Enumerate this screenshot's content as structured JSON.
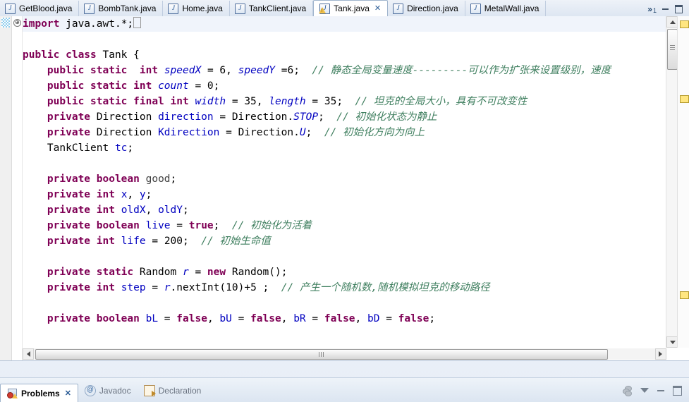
{
  "window": {
    "minimize_label": "Minimize",
    "maximize_label": "Maximize"
  },
  "editor_tabs": {
    "overflow_indicator": "»",
    "overflow_count": "1",
    "items": [
      {
        "label": "GetBlood.java",
        "icon": "java-file-icon",
        "active": false,
        "warning": false
      },
      {
        "label": "BombTank.java",
        "icon": "java-file-icon",
        "active": false,
        "warning": false
      },
      {
        "label": "Home.java",
        "icon": "java-file-icon",
        "active": false,
        "warning": false
      },
      {
        "label": "TankClient.java",
        "icon": "java-file-icon",
        "active": false,
        "warning": false
      },
      {
        "label": "Tank.java",
        "icon": "java-file-warning-icon",
        "active": true,
        "warning": true,
        "close": "✕"
      },
      {
        "label": "Direction.java",
        "icon": "java-file-icon",
        "active": false,
        "warning": false
      },
      {
        "label": "MetalWall.java",
        "icon": "java-file-icon",
        "active": false,
        "warning": false
      }
    ]
  },
  "code": {
    "fold_marker": "⊕",
    "lines": [
      {
        "tokens": [
          {
            "t": "kw",
            "v": "import"
          },
          {
            "t": "plain",
            "v": " java.awt.*;"
          },
          {
            "t": "caret",
            "v": ""
          }
        ],
        "highlight": true
      },
      {
        "tokens": []
      },
      {
        "tokens": [
          {
            "t": "kw",
            "v": "public class"
          },
          {
            "t": "plain",
            "v": " Tank {"
          }
        ]
      },
      {
        "tokens": [
          {
            "t": "plain",
            "v": "    "
          },
          {
            "t": "kw",
            "v": "public static"
          },
          {
            "t": "plain",
            "v": "  "
          },
          {
            "t": "kw",
            "v": "int"
          },
          {
            "t": "plain",
            "v": " "
          },
          {
            "t": "sfld",
            "v": "speedX"
          },
          {
            "t": "plain",
            "v": " = "
          },
          {
            "t": "num",
            "v": "6"
          },
          {
            "t": "plain",
            "v": ", "
          },
          {
            "t": "sfld",
            "v": "speedY"
          },
          {
            "t": "plain",
            "v": " ="
          },
          {
            "t": "num",
            "v": "6"
          },
          {
            "t": "plain",
            "v": ";  "
          },
          {
            "t": "cmt",
            "v": "// 静态全局变量速度---------可以作为扩张来设置级别，速度"
          }
        ]
      },
      {
        "tokens": [
          {
            "t": "plain",
            "v": "    "
          },
          {
            "t": "kw",
            "v": "public static int"
          },
          {
            "t": "plain",
            "v": " "
          },
          {
            "t": "sfld",
            "v": "count"
          },
          {
            "t": "plain",
            "v": " = "
          },
          {
            "t": "num",
            "v": "0"
          },
          {
            "t": "plain",
            "v": ";"
          }
        ]
      },
      {
        "tokens": [
          {
            "t": "plain",
            "v": "    "
          },
          {
            "t": "kw",
            "v": "public static final int"
          },
          {
            "t": "plain",
            "v": " "
          },
          {
            "t": "sfld",
            "v": "width"
          },
          {
            "t": "plain",
            "v": " = "
          },
          {
            "t": "num",
            "v": "35"
          },
          {
            "t": "plain",
            "v": ", "
          },
          {
            "t": "sfld",
            "v": "length"
          },
          {
            "t": "plain",
            "v": " = "
          },
          {
            "t": "num",
            "v": "35"
          },
          {
            "t": "plain",
            "v": ";  "
          },
          {
            "t": "cmt",
            "v": "// 坦克的全局大小，具有不可改变性"
          }
        ]
      },
      {
        "tokens": [
          {
            "t": "plain",
            "v": "    "
          },
          {
            "t": "kw",
            "v": "private"
          },
          {
            "t": "plain",
            "v": " Direction "
          },
          {
            "t": "fld",
            "v": "direction"
          },
          {
            "t": "plain",
            "v": " = Direction."
          },
          {
            "t": "sfld",
            "v": "STOP"
          },
          {
            "t": "plain",
            "v": ";  "
          },
          {
            "t": "cmt",
            "v": "// 初始化状态为静止"
          }
        ]
      },
      {
        "tokens": [
          {
            "t": "plain",
            "v": "    "
          },
          {
            "t": "kw",
            "v": "private"
          },
          {
            "t": "plain",
            "v": " Direction "
          },
          {
            "t": "fld",
            "v": "Kdirection"
          },
          {
            "t": "plain",
            "v": " = Direction."
          },
          {
            "t": "sfld",
            "v": "U"
          },
          {
            "t": "plain",
            "v": ";  "
          },
          {
            "t": "cmt",
            "v": "// 初始化方向为向上"
          }
        ]
      },
      {
        "tokens": [
          {
            "t": "plain",
            "v": "    TankClient "
          },
          {
            "t": "fld",
            "v": "tc"
          },
          {
            "t": "plain",
            "v": ";"
          }
        ]
      },
      {
        "tokens": []
      },
      {
        "tokens": [
          {
            "t": "plain",
            "v": "    "
          },
          {
            "t": "kw",
            "v": "private boolean"
          },
          {
            "t": "plain",
            "v": " "
          },
          {
            "t": "grey",
            "v": "good"
          },
          {
            "t": "plain",
            "v": ";"
          }
        ]
      },
      {
        "tokens": [
          {
            "t": "plain",
            "v": "    "
          },
          {
            "t": "kw",
            "v": "private int"
          },
          {
            "t": "plain",
            "v": " "
          },
          {
            "t": "fld",
            "v": "x"
          },
          {
            "t": "plain",
            "v": ", "
          },
          {
            "t": "fld",
            "v": "y"
          },
          {
            "t": "plain",
            "v": ";"
          }
        ]
      },
      {
        "tokens": [
          {
            "t": "plain",
            "v": "    "
          },
          {
            "t": "kw",
            "v": "private int"
          },
          {
            "t": "plain",
            "v": " "
          },
          {
            "t": "fld",
            "v": "oldX"
          },
          {
            "t": "plain",
            "v": ", "
          },
          {
            "t": "fld",
            "v": "oldY"
          },
          {
            "t": "plain",
            "v": ";"
          }
        ]
      },
      {
        "tokens": [
          {
            "t": "plain",
            "v": "    "
          },
          {
            "t": "kw",
            "v": "private boolean"
          },
          {
            "t": "plain",
            "v": " "
          },
          {
            "t": "fld",
            "v": "live"
          },
          {
            "t": "plain",
            "v": " = "
          },
          {
            "t": "kw",
            "v": "true"
          },
          {
            "t": "plain",
            "v": ";  "
          },
          {
            "t": "cmt",
            "v": "// 初始化为活着"
          }
        ]
      },
      {
        "tokens": [
          {
            "t": "plain",
            "v": "    "
          },
          {
            "t": "kw",
            "v": "private int"
          },
          {
            "t": "plain",
            "v": " "
          },
          {
            "t": "fld",
            "v": "life"
          },
          {
            "t": "plain",
            "v": " = "
          },
          {
            "t": "num",
            "v": "200"
          },
          {
            "t": "plain",
            "v": ";  "
          },
          {
            "t": "cmt",
            "v": "// 初始生命值"
          }
        ]
      },
      {
        "tokens": []
      },
      {
        "tokens": [
          {
            "t": "plain",
            "v": "    "
          },
          {
            "t": "kw",
            "v": "private static"
          },
          {
            "t": "plain",
            "v": " Random "
          },
          {
            "t": "sfld",
            "v": "r"
          },
          {
            "t": "plain",
            "v": " = "
          },
          {
            "t": "kw",
            "v": "new"
          },
          {
            "t": "plain",
            "v": " Random();"
          }
        ]
      },
      {
        "tokens": [
          {
            "t": "plain",
            "v": "    "
          },
          {
            "t": "kw",
            "v": "private int"
          },
          {
            "t": "plain",
            "v": " "
          },
          {
            "t": "fld",
            "v": "step"
          },
          {
            "t": "plain",
            "v": " = "
          },
          {
            "t": "sfld",
            "v": "r"
          },
          {
            "t": "plain",
            "v": ".nextInt("
          },
          {
            "t": "num",
            "v": "10"
          },
          {
            "t": "plain",
            "v": ")+"
          },
          {
            "t": "num",
            "v": "5"
          },
          {
            "t": "plain",
            "v": " ;  "
          },
          {
            "t": "cmt",
            "v": "// 产生一个随机数,随机模拟坦克的移动路径"
          }
        ]
      },
      {
        "tokens": []
      },
      {
        "tokens": [
          {
            "t": "plain",
            "v": "    "
          },
          {
            "t": "kw",
            "v": "private boolean"
          },
          {
            "t": "plain",
            "v": " "
          },
          {
            "t": "fld",
            "v": "bL"
          },
          {
            "t": "plain",
            "v": " = "
          },
          {
            "t": "kw",
            "v": "false"
          },
          {
            "t": "plain",
            "v": ", "
          },
          {
            "t": "fld",
            "v": "bU"
          },
          {
            "t": "plain",
            "v": " = "
          },
          {
            "t": "kw",
            "v": "false"
          },
          {
            "t": "plain",
            "v": ", "
          },
          {
            "t": "fld",
            "v": "bR"
          },
          {
            "t": "plain",
            "v": " = "
          },
          {
            "t": "kw",
            "v": "false"
          },
          {
            "t": "plain",
            "v": ", "
          },
          {
            "t": "fld",
            "v": "bD"
          },
          {
            "t": "plain",
            "v": " = "
          },
          {
            "t": "kw",
            "v": "false"
          },
          {
            "t": "plain",
            "v": ";"
          }
        ]
      }
    ]
  },
  "bottom_view": {
    "tabs": [
      {
        "label": "Problems",
        "icon": "problems-icon",
        "active": true,
        "close": "✕"
      },
      {
        "label": "Javadoc",
        "icon": "javadoc-at-icon",
        "active": false
      },
      {
        "label": "Declaration",
        "icon": "declaration-icon",
        "active": false
      }
    ],
    "tools": [
      {
        "name": "filter-icon"
      },
      {
        "name": "view-menu-icon"
      },
      {
        "name": "minimize-icon"
      },
      {
        "name": "maximize-icon"
      }
    ]
  },
  "colors": {
    "keyword": "#7f0055",
    "field": "#0000c0",
    "comment": "#3f7f5f",
    "editor_bg": "#ffffff",
    "chrome_bg": "#e8eef7"
  }
}
